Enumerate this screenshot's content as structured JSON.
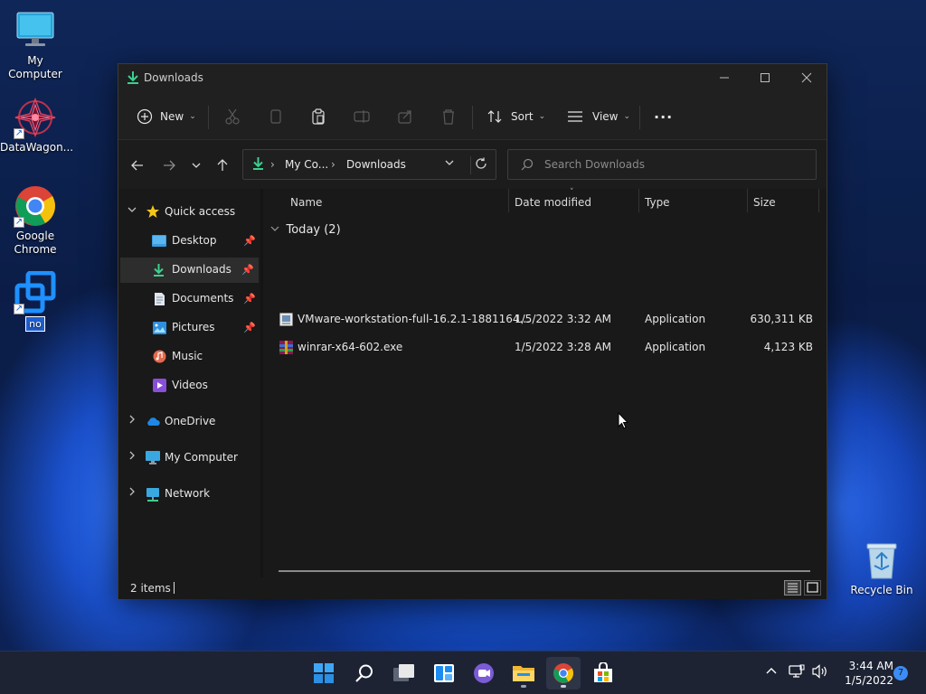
{
  "desktop": {
    "icons": [
      {
        "label": "My Computer"
      },
      {
        "label": "DataWagon..."
      },
      {
        "label": "Google Chrome"
      },
      {
        "label": "no"
      },
      {
        "label": "Recycle Bin"
      }
    ]
  },
  "window": {
    "title": "Downloads",
    "toolbar": {
      "new_label": "New",
      "sort_label": "Sort",
      "view_label": "View",
      "more_label": "..."
    },
    "address": {
      "crumb1": "My Co...",
      "crumb2": "Downloads"
    },
    "search": {
      "placeholder": "Search Downloads"
    },
    "nav": {
      "quick_access": "Quick access",
      "items": [
        {
          "label": "Desktop",
          "pinned": true
        },
        {
          "label": "Downloads",
          "pinned": true,
          "selected": true
        },
        {
          "label": "Documents",
          "pinned": true
        },
        {
          "label": "Pictures",
          "pinned": true
        },
        {
          "label": "Music",
          "pinned": false
        },
        {
          "label": "Videos",
          "pinned": false
        }
      ],
      "onedrive": "OneDrive",
      "my_computer": "My Computer",
      "network": "Network"
    },
    "columns": {
      "name": "Name",
      "date": "Date modified",
      "type": "Type",
      "size": "Size"
    },
    "group": "Today (2)",
    "files": [
      {
        "name": "VMware-workstation-full-16.2.1-1881164...",
        "date": "1/5/2022 3:32 AM",
        "type": "Application",
        "size": "630,311 KB"
      },
      {
        "name": "winrar-x64-602.exe",
        "date": "1/5/2022 3:28 AM",
        "type": "Application",
        "size": "4,123 KB"
      }
    ],
    "status": {
      "items": "2 items"
    }
  },
  "taskbar": {
    "apps": [
      "start-icon",
      "search-icon",
      "task-view-icon",
      "widgets-icon",
      "chat-icon",
      "file-explorer-icon",
      "chrome-icon",
      "store-icon"
    ],
    "clock": {
      "time": "3:44 AM",
      "date": "1/5/2022"
    },
    "notification_count": "7"
  },
  "colors": {
    "accent": "#3b8cf5",
    "window_bg": "#191919",
    "taskbar_bg": "#1d2333"
  }
}
